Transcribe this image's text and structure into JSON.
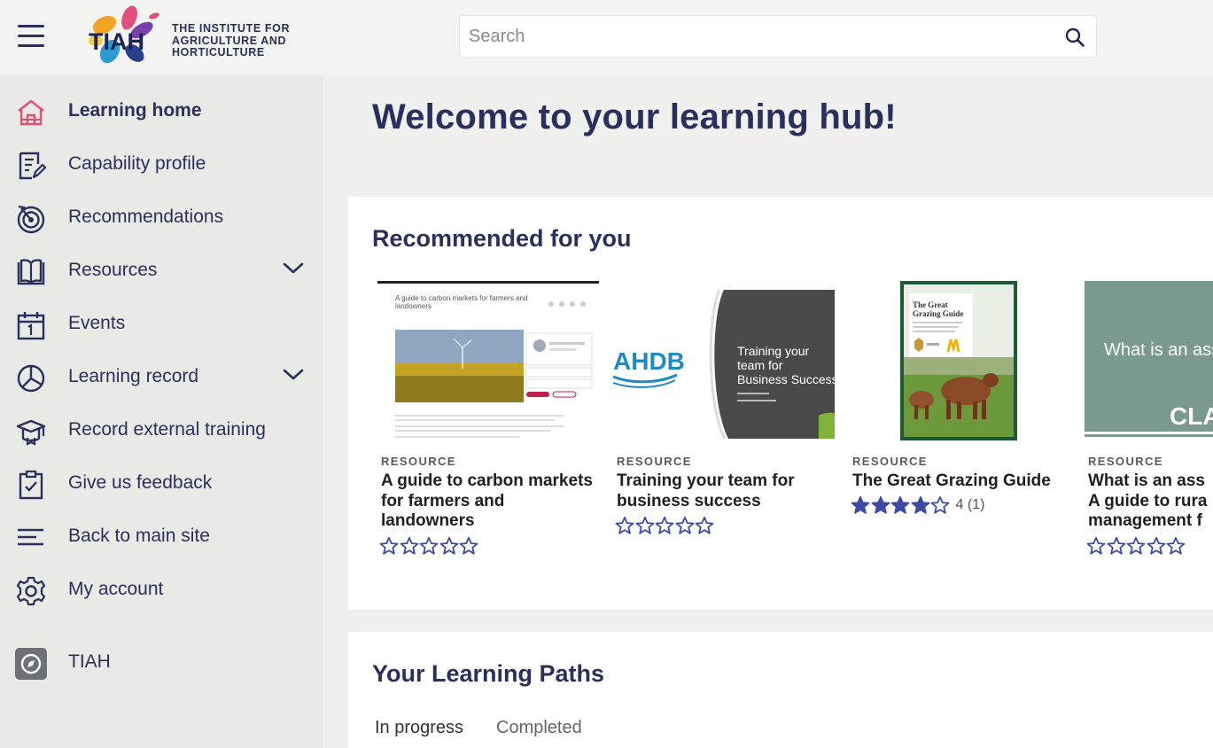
{
  "header": {
    "logo_short": "TIAH",
    "logo_text_line1": "THE INSTITUTE FOR",
    "logo_text_line2": "AGRICULTURE AND",
    "logo_text_line3": "HORTICULTURE",
    "search_placeholder": "Search"
  },
  "sidebar": {
    "items": [
      {
        "label": "Learning home",
        "icon": "home-icon",
        "active": true
      },
      {
        "label": "Capability profile",
        "icon": "edit-document-icon"
      },
      {
        "label": "Recommendations",
        "icon": "target-icon"
      },
      {
        "label": "Resources",
        "icon": "book-icon",
        "expandable": true
      },
      {
        "label": "Events",
        "icon": "calendar-icon"
      },
      {
        "label": "Learning record",
        "icon": "pie-chart-icon",
        "expandable": true
      },
      {
        "label": "Record external training",
        "icon": "graduation-cap-icon"
      },
      {
        "label": "Give us feedback",
        "icon": "clipboard-check-icon"
      },
      {
        "label": "Back to main site",
        "icon": "lines-icon"
      },
      {
        "label": "My account",
        "icon": "gear-icon"
      },
      {
        "label": "TIAH",
        "icon": "compass-icon"
      }
    ]
  },
  "main": {
    "welcome": "Welcome to your learning hub!",
    "recommended": {
      "title": "Recommended for you",
      "cards": [
        {
          "type": "RESOURCE",
          "title": "A guide to carbon markets for farmers and landowners",
          "rating": 0,
          "thumb_title": "A guide to carbon markets for farmers and landowners"
        },
        {
          "type": "RESOURCE",
          "title": "Training your team for business success",
          "rating": 0,
          "thumb_brand": "AHDB",
          "thumb_text_line1": "Training your",
          "thumb_text_line2": "team for",
          "thumb_text_line3": "Business Success"
        },
        {
          "type": "RESOURCE",
          "title": "The Great Grazing Guide",
          "rating": 4,
          "rating_text": "4 (1)",
          "thumb_title_line1": "The Great",
          "thumb_title_line2": "Grazing Guide"
        },
        {
          "type": "RESOURCE",
          "title": "What is an ass A guide to rura management f",
          "title_line1": "What is an ass",
          "title_line2": "A guide to rura",
          "title_line3": "management f",
          "rating": 0,
          "thumb_text": "What is an ass",
          "thumb_brand": "CLA"
        }
      ]
    },
    "paths": {
      "title": "Your Learning Paths",
      "tabs": [
        "In progress",
        "Completed"
      ]
    }
  },
  "colors": {
    "navy": "#2a2f5e",
    "active_icon": "#e24f7a",
    "star": "#3d4aa5",
    "sidebar_bg": "#e9e9e6"
  }
}
